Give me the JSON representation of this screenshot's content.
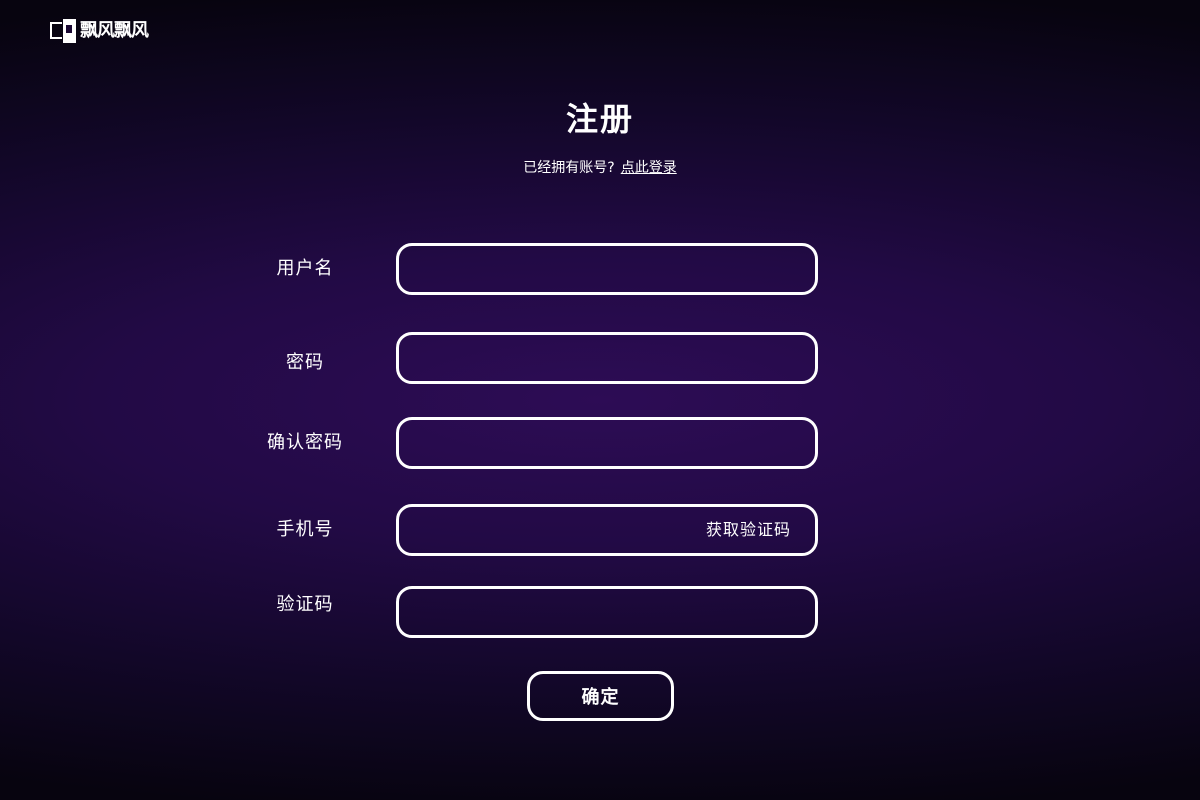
{
  "brand": {
    "logo_text": "飘风飘风"
  },
  "page": {
    "title": "注册",
    "subtitle_text": "已经拥有账号?",
    "login_link": "点此登录"
  },
  "form": {
    "username": {
      "label": "用户名",
      "value": "",
      "placeholder": ""
    },
    "password": {
      "label": "密码",
      "value": "",
      "placeholder": ""
    },
    "confirm_password": {
      "label": "确认密码",
      "value": "",
      "placeholder": ""
    },
    "phone": {
      "label": "手机号",
      "value": "",
      "placeholder": "",
      "action_label": "获取验证码"
    },
    "verification_code": {
      "label": "验证码",
      "value": "",
      "placeholder": ""
    },
    "submit_label": "确定"
  },
  "colors": {
    "text": "#ffffff",
    "border": "#ffffff",
    "background_center": "#2d0c55",
    "background_edge": "#07040f"
  }
}
